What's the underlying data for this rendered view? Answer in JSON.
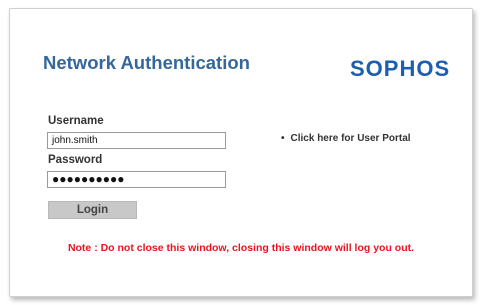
{
  "header": {
    "title": "Network Authentication",
    "logo_text": "SOPHOS"
  },
  "form": {
    "username_label": "Username",
    "username_value": "john.smith",
    "password_label": "Password",
    "password_masked": "●●●●●●●●●●",
    "login_label": "Login"
  },
  "portal": {
    "bullet": "•",
    "link_text": "Click here for User Portal"
  },
  "note": {
    "text": "Note : Do not close this window, closing this window will log you out."
  },
  "colors": {
    "title": "#35679a",
    "logo": "#1d5fae",
    "note": "#e8141c",
    "button_bg": "#c8c8c8"
  }
}
